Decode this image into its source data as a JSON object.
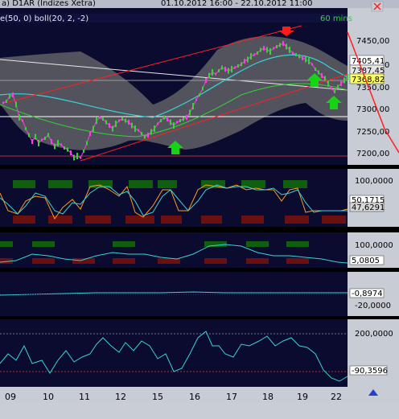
{
  "window": {
    "title_left": "a) D1AR (Indizes Xetra)",
    "title_dates": "01.10.2012 16:00 - 22.10.2012 11:00"
  },
  "main": {
    "indicator_label": "e(50, 0) boll(20, 2, -2)",
    "timeframe": "60 mins",
    "y_ticks": [
      "7450,00",
      "7400,00",
      "7350,00",
      "7300,00",
      "7250,00",
      "7200,00"
    ],
    "price_tag_1": "7405,41",
    "price_tag_2": "7387,45",
    "price_tag_3": "7368,82",
    "price_tag_4": "7350,00"
  },
  "stoch": {
    "y_top": "100,0000",
    "value_1": "50,1715",
    "value_2": "47,6291"
  },
  "rsi": {
    "y_top": "100,0000",
    "value": "5,0805"
  },
  "osc3": {
    "value": "-0,8974",
    "y_tick": "-20,0000"
  },
  "cci": {
    "y_top": "200,0000",
    "value": "-90,3596"
  },
  "x_axis": {
    "labels": [
      "09",
      "10",
      "11",
      "12",
      "15",
      "16",
      "17",
      "18",
      "19",
      "22"
    ]
  },
  "colors": {
    "background": "#0b0b30",
    "up_candle": "#35d335",
    "down_candle": "#ff3de1",
    "trend_line": "#ff2020",
    "band_fill": "#6c6c6c"
  }
}
